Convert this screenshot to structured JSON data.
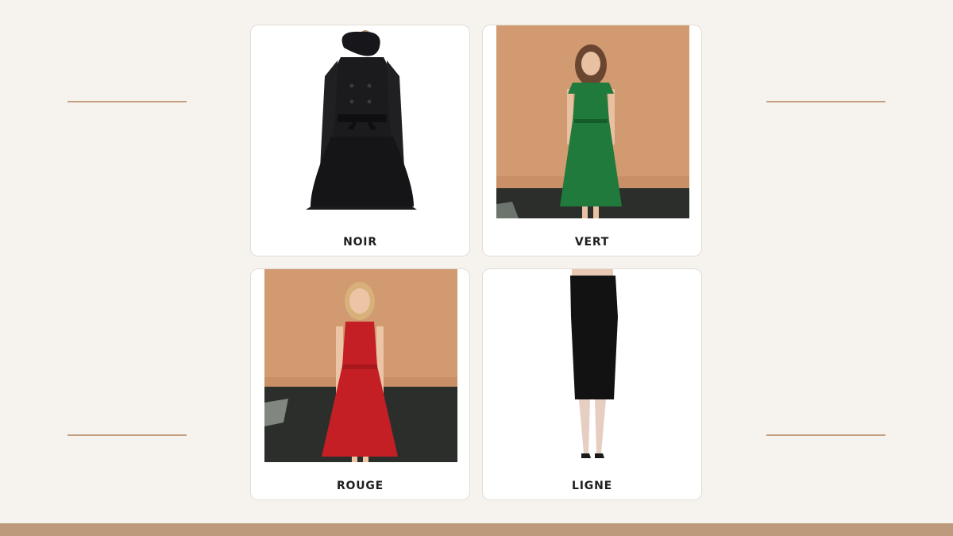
{
  "colors": {
    "background": "#f6f3ef",
    "accent": "#c4a080",
    "bottom_bar": "#bd9a7c"
  },
  "cards": [
    {
      "label": "NOIR",
      "image": "black-wool-coat"
    },
    {
      "label": "VERT",
      "image": "woman-green-dress"
    },
    {
      "label": "ROUGE",
      "image": "woman-red-dress"
    },
    {
      "label": "LIGNE",
      "image": "black-pencil-skirt"
    }
  ]
}
